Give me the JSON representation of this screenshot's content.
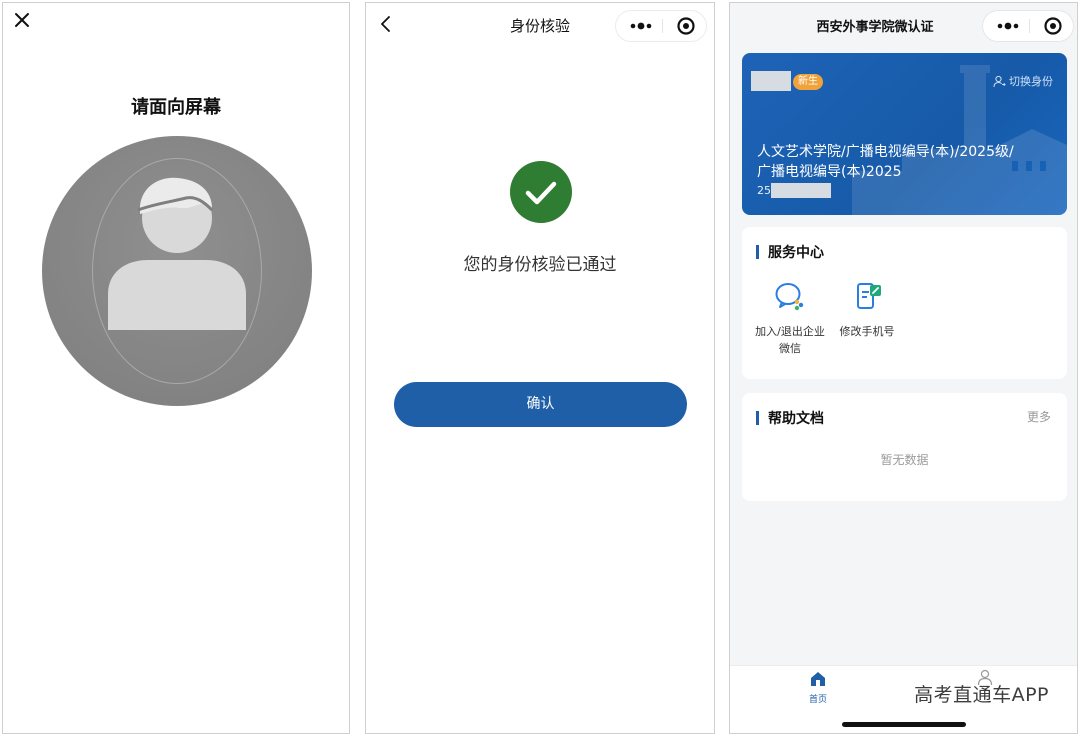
{
  "colors": {
    "primary_blue": "#1f5fa8",
    "success_green": "#2f7d32",
    "badge_orange": "#f0a33a"
  },
  "panel1": {
    "close_icon": "close-icon",
    "title": "请面向屏幕"
  },
  "panel2": {
    "nav_title": "身份核验",
    "status_text": "您的身份核验已通过",
    "confirm_label": "确认"
  },
  "panel3": {
    "title": "西安外事学院微认证",
    "card": {
      "badge": "新生",
      "switch_label": "切换身份",
      "line1": "人文艺术学院/广播电视编导(本)/2025级/",
      "line2": "广播电视编导(本)2025",
      "id_prefix": "25"
    },
    "services": {
      "title": "服务中心",
      "items": [
        {
          "label": "加入/退出企业微信",
          "icon": "wecom-icon"
        },
        {
          "label": "修改手机号",
          "icon": "phone-edit-icon"
        }
      ]
    },
    "help": {
      "title": "帮助文档",
      "more": "更多",
      "empty": "暂无数据"
    },
    "tabbar": {
      "home_label": "首页"
    },
    "watermark": "高考直通车APP"
  }
}
